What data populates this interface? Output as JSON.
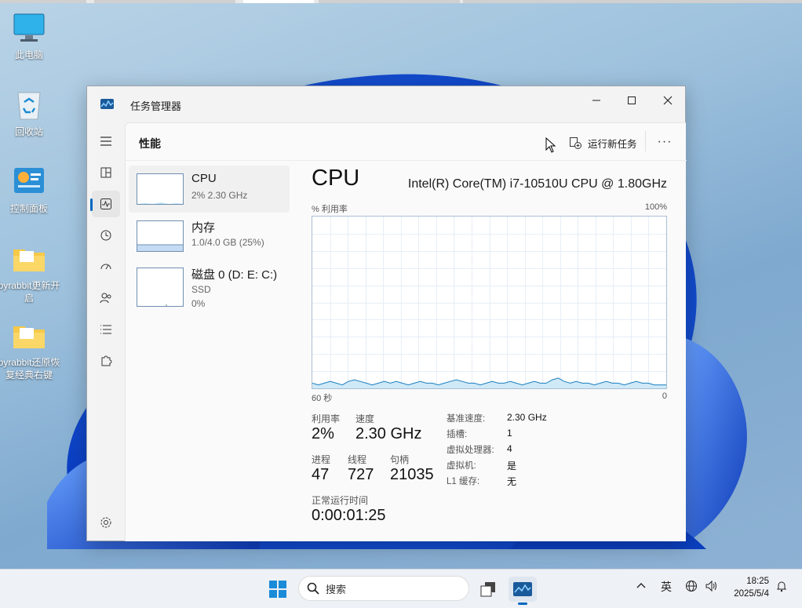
{
  "desktop": {
    "icons": [
      {
        "label": "此电脑"
      },
      {
        "label": "回收站"
      },
      {
        "label": "控制面板"
      },
      {
        "label": "byrabbit更新开启"
      },
      {
        "label": "byrabbit还原恢复经典右键"
      }
    ]
  },
  "window": {
    "title": "任务管理器",
    "page_title": "性能",
    "run_new_task": "运行新任务",
    "more": "···",
    "perf_items": [
      {
        "name": "CPU",
        "sub1": "2% 2.30 GHz",
        "sub2": "",
        "sub3": ""
      },
      {
        "name": "内存",
        "sub1": "1.0/4.0 GB (25%)",
        "sub2": "",
        "sub3": ""
      },
      {
        "name": "磁盘 0 (D: E: C:)",
        "sub1": "SSD",
        "sub2": "0%",
        "sub3": ""
      }
    ],
    "cpu": {
      "heading": "CPU",
      "model": "Intel(R) Core(TM) i7-10510U CPU @ 1.80GHz",
      "graph_label_top_left": "% 利用率",
      "graph_label_top_right": "100%",
      "graph_label_bottom_left": "60 秒",
      "graph_label_bottom_right": "0",
      "stats": {
        "utilization_label": "利用率",
        "utilization": "2%",
        "speed_label": "速度",
        "speed": "2.30 GHz",
        "processes_label": "进程",
        "processes": "47",
        "threads_label": "线程",
        "threads": "727",
        "handles_label": "句柄",
        "handles": "21035",
        "uptime_label": "正常运行时间",
        "uptime": "0:00:01:25"
      },
      "details": [
        {
          "k": "基准速度:",
          "v": "2.30 GHz"
        },
        {
          "k": "插槽:",
          "v": "1"
        },
        {
          "k": "虚拟处理器:",
          "v": "4"
        },
        {
          "k": "虚拟机:",
          "v": "是"
        },
        {
          "k": "L1 缓存:",
          "v": "无"
        }
      ]
    }
  },
  "chart_data": {
    "type": "area",
    "title": "",
    "xlabel": "",
    "ylabel": "% 利用率",
    "ylim": [
      0,
      100
    ],
    "x_range_seconds": [
      60,
      0
    ],
    "series": [
      {
        "values": [
          3,
          2,
          3,
          4,
          3,
          2,
          4,
          5,
          4,
          3,
          2,
          3,
          4,
          3,
          4,
          3,
          2,
          3,
          4,
          3,
          3,
          2,
          3,
          4,
          5,
          4,
          3,
          3,
          2,
          3,
          4,
          3,
          3,
          4,
          3,
          2,
          3,
          4,
          3,
          3,
          5,
          6,
          4,
          3,
          4,
          3,
          3,
          2,
          3,
          4,
          3,
          3,
          2,
          3,
          4,
          3,
          3,
          2,
          2,
          2
        ]
      }
    ],
    "grid": true,
    "accent_color": "#1a7fc0"
  },
  "taskbar": {
    "search_placeholder": "搜索",
    "ime": "英",
    "time": "18:25",
    "date": "2025/5/4"
  }
}
